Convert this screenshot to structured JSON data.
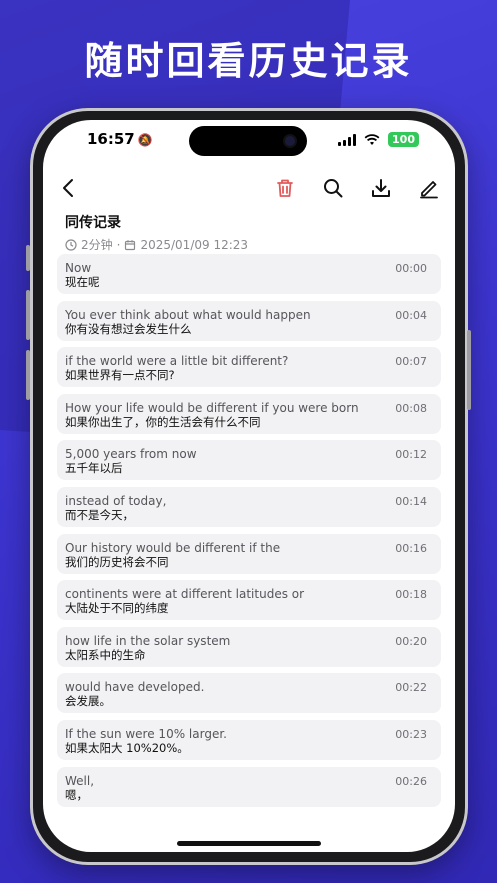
{
  "headline": "随时回看历史记录",
  "status_bar": {
    "time": "16:57",
    "battery": "100"
  },
  "toolbar": {
    "back_icon": "chevron-left-icon",
    "delete_icon": "trash-icon",
    "search_icon": "search-icon",
    "download_icon": "download-icon",
    "edit_icon": "pencil-icon",
    "delete_color": "#e25a5a"
  },
  "record": {
    "title": "同传记录",
    "duration": "2分钟",
    "separator": "·",
    "datetime": "2025/01/09 12:23"
  },
  "entries": [
    {
      "en": "Now",
      "zh": "现在呢",
      "time": "00:00"
    },
    {
      "en": "You ever think about what would happen",
      "zh": "你有没有想过会发生什么",
      "time": "00:04"
    },
    {
      "en": "if the world were a little bit different?",
      "zh": "如果世界有一点不同?",
      "time": "00:07"
    },
    {
      "en": "How your life would be different if you were born",
      "zh": "如果你出生了，你的生活会有什么不同",
      "time": "00:08"
    },
    {
      "en": "5,000 years from now",
      "zh": "五千年以后",
      "time": "00:12"
    },
    {
      "en": "instead of today,",
      "zh": "而不是今天，",
      "time": "00:14"
    },
    {
      "en": "Our history would be different if the",
      "zh": "我们的历史将会不同",
      "time": "00:16"
    },
    {
      "en": "continents were at different latitudes or",
      "zh": "大陆处于不同的纬度",
      "time": "00:18"
    },
    {
      "en": "how life in the solar system",
      "zh": "太阳系中的生命",
      "time": "00:20"
    },
    {
      "en": "would have developed.",
      "zh": "会发展。",
      "time": "00:22"
    },
    {
      "en": "If the sun were 10% larger.",
      "zh": "如果太阳大 10%20%。",
      "time": "00:23"
    },
    {
      "en": "Well,",
      "zh": "嗯，",
      "time": "00:26"
    }
  ]
}
